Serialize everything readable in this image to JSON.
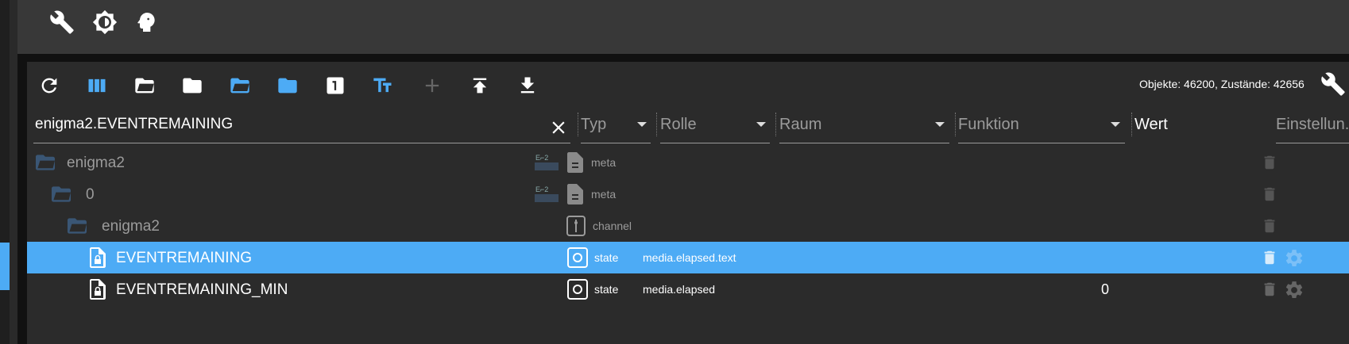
{
  "toolbar_stats": "Objekte: 46200, Zustände: 42656",
  "search": {
    "value": "enigma2.EVENTREMAINING"
  },
  "columns": {
    "type": "Typ",
    "role": "Rolle",
    "room": "Raum",
    "function": "Funktion",
    "value": "Wert",
    "settings": "Einstellun..."
  },
  "rows": [
    {
      "name": "enigma2",
      "type": "meta",
      "role": "",
      "value": ""
    },
    {
      "name": "0",
      "type": "meta",
      "role": "",
      "value": ""
    },
    {
      "name": "enigma2",
      "type": "channel",
      "role": "",
      "value": ""
    },
    {
      "name": "EVENTREMAINING",
      "type": "state",
      "role": "media.elapsed.text",
      "value": ""
    },
    {
      "name": "EVENTREMAINING_MIN",
      "type": "state",
      "role": "media.elapsed",
      "value": "0"
    }
  ],
  "colors": {
    "accent": "#4dabf5",
    "panel": "#2b2b2b",
    "appbar": "#383838"
  },
  "icons": [
    "wrench-icon",
    "brightness-icon",
    "head-icon",
    "refresh-icon",
    "columns-icon",
    "folder-open-icon",
    "folder-icon",
    "folder-open-blue-icon",
    "folder-blue-icon",
    "one-icon",
    "text-size-icon",
    "plus-icon",
    "upload-icon",
    "download-icon",
    "wrench-small-icon",
    "clear-icon",
    "trash-icon",
    "gear-icon",
    "file-lock-icon",
    "adapter-logo-icon",
    "document-icon",
    "channel-icon",
    "state-icon"
  ]
}
